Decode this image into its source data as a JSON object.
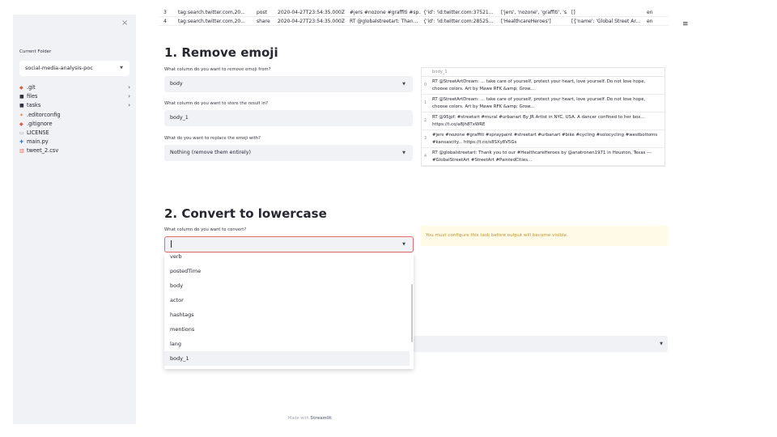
{
  "sidebar": {
    "close_glyph": "×",
    "current_folder_label": "Current Folder",
    "folder_select_value": "social-media-analysis-poc",
    "tree": [
      {
        "icon": "git-icon",
        "glyph": "◆",
        "color": "#e3573a",
        "label": ".git",
        "chevron": "›"
      },
      {
        "icon": "folder-icon",
        "glyph": "■",
        "color": "#31333f",
        "label": "files",
        "chevron": "›"
      },
      {
        "icon": "folder-icon",
        "glyph": "■",
        "color": "#31333f",
        "label": "tasks",
        "chevron": "›"
      },
      {
        "icon": "editorconfig-icon",
        "glyph": "✶",
        "color": "#d07a29",
        "label": ".editorconfig",
        "chevron": ""
      },
      {
        "icon": "git-icon",
        "glyph": "◆",
        "color": "#e3573a",
        "label": ".gitignore",
        "chevron": ""
      },
      {
        "icon": "license-icon",
        "glyph": "▭",
        "color": "#8a8d97",
        "label": "LICENSE",
        "chevron": ""
      },
      {
        "icon": "python-icon",
        "glyph": "✚",
        "color": "#3e7bb8",
        "label": "main.py",
        "chevron": ""
      },
      {
        "icon": "csv-icon",
        "glyph": "▥",
        "color": "#e06b5a",
        "label": "tweet_2.csv",
        "chevron": ""
      }
    ]
  },
  "top_table": {
    "rows": [
      {
        "idx": "3",
        "id": "tag:search.twitter.com,20...",
        "verb": "post",
        "time": "2020-04-27T23:54:35.000Z",
        "body": "#jers #nozone #graffiti #sp...",
        "actor": "{'id': 'id:twitter.com:37521...",
        "hashtags": "['jers', 'nozone', 'graffiti', 's...",
        "mentions": "[]",
        "lang": "en"
      },
      {
        "idx": "4",
        "id": "tag:search.twitter.com,20...",
        "verb": "share",
        "time": "2020-04-27T23:54:35.000Z",
        "body": "RT @globalstreetart: Than...",
        "actor": "{'id': 'id:twitter.com:28525...",
        "hashtags": "['HealthcareHeroes']",
        "mentions": "[{'name': 'Global Street Ar...",
        "lang": "en"
      }
    ]
  },
  "menu_glyph": "≡",
  "section1": {
    "title": "1. Remove emoji",
    "q1_label": "What column do you want to remove emoji from?",
    "q1_value": "body",
    "q2_label": "What column do you want to store the result in?",
    "q2_value": "body_1",
    "q3_label": "What do you want to replace the emoji with?",
    "q3_value": "Nothing (remove them entirely)"
  },
  "output_df": {
    "header": "body_1",
    "rows": [
      {
        "idx": "0",
        "text": "RT @StreetArtDream: ... take care of yourself, protect your heart, love yourself. Do not lose hope, choose colors. Art by Mawe RFK &amp; Grow..."
      },
      {
        "idx": "1",
        "text": "RT @StreetArtDream: ... take care of yourself, protect your heart, love yourself. Do not lose hope, choose colors. Art by Mawe RFK &amp; Grow..."
      },
      {
        "idx": "2",
        "text": "RT @95jpf: #streetart #mural #urbanart By JR Artist in NYC, USA. A dancer confined to her box... https://t.co/a8Jh8TxWRE"
      },
      {
        "idx": "3",
        "text": "#jers #nozone #graffiti #spraypaint #streetart #urbanart #bike #cycling #solocycling #westbottoms #kansascity... https://t.co/s8SXy8V5Gs"
      },
      {
        "idx": "4",
        "text": "RT @globalstreetart: Thank you to our #HealthcareHeroes by @anatronen1971 in Houston, Texas --- #GlobalStreetArt #StreetArt #PaintedCities..."
      }
    ]
  },
  "section2": {
    "title": "2. Convert to lowercase",
    "q1_label": "What column do you want to convert?",
    "q1_value": "",
    "warning": "You must configure this task before output will become visible.",
    "options": [
      "verb",
      "postedTime",
      "body",
      "actor",
      "hashtags",
      "mentions",
      "lang",
      "body_1"
    ],
    "selected_option": "body_1"
  },
  "footer": {
    "prefix": "Made with",
    "brand": "Streamlit"
  },
  "colors": {
    "accent": "#e46a6f",
    "sidebar_bg": "#f0f2f6",
    "warning_bg": "#fffbe6",
    "warning_text": "#b89435"
  }
}
